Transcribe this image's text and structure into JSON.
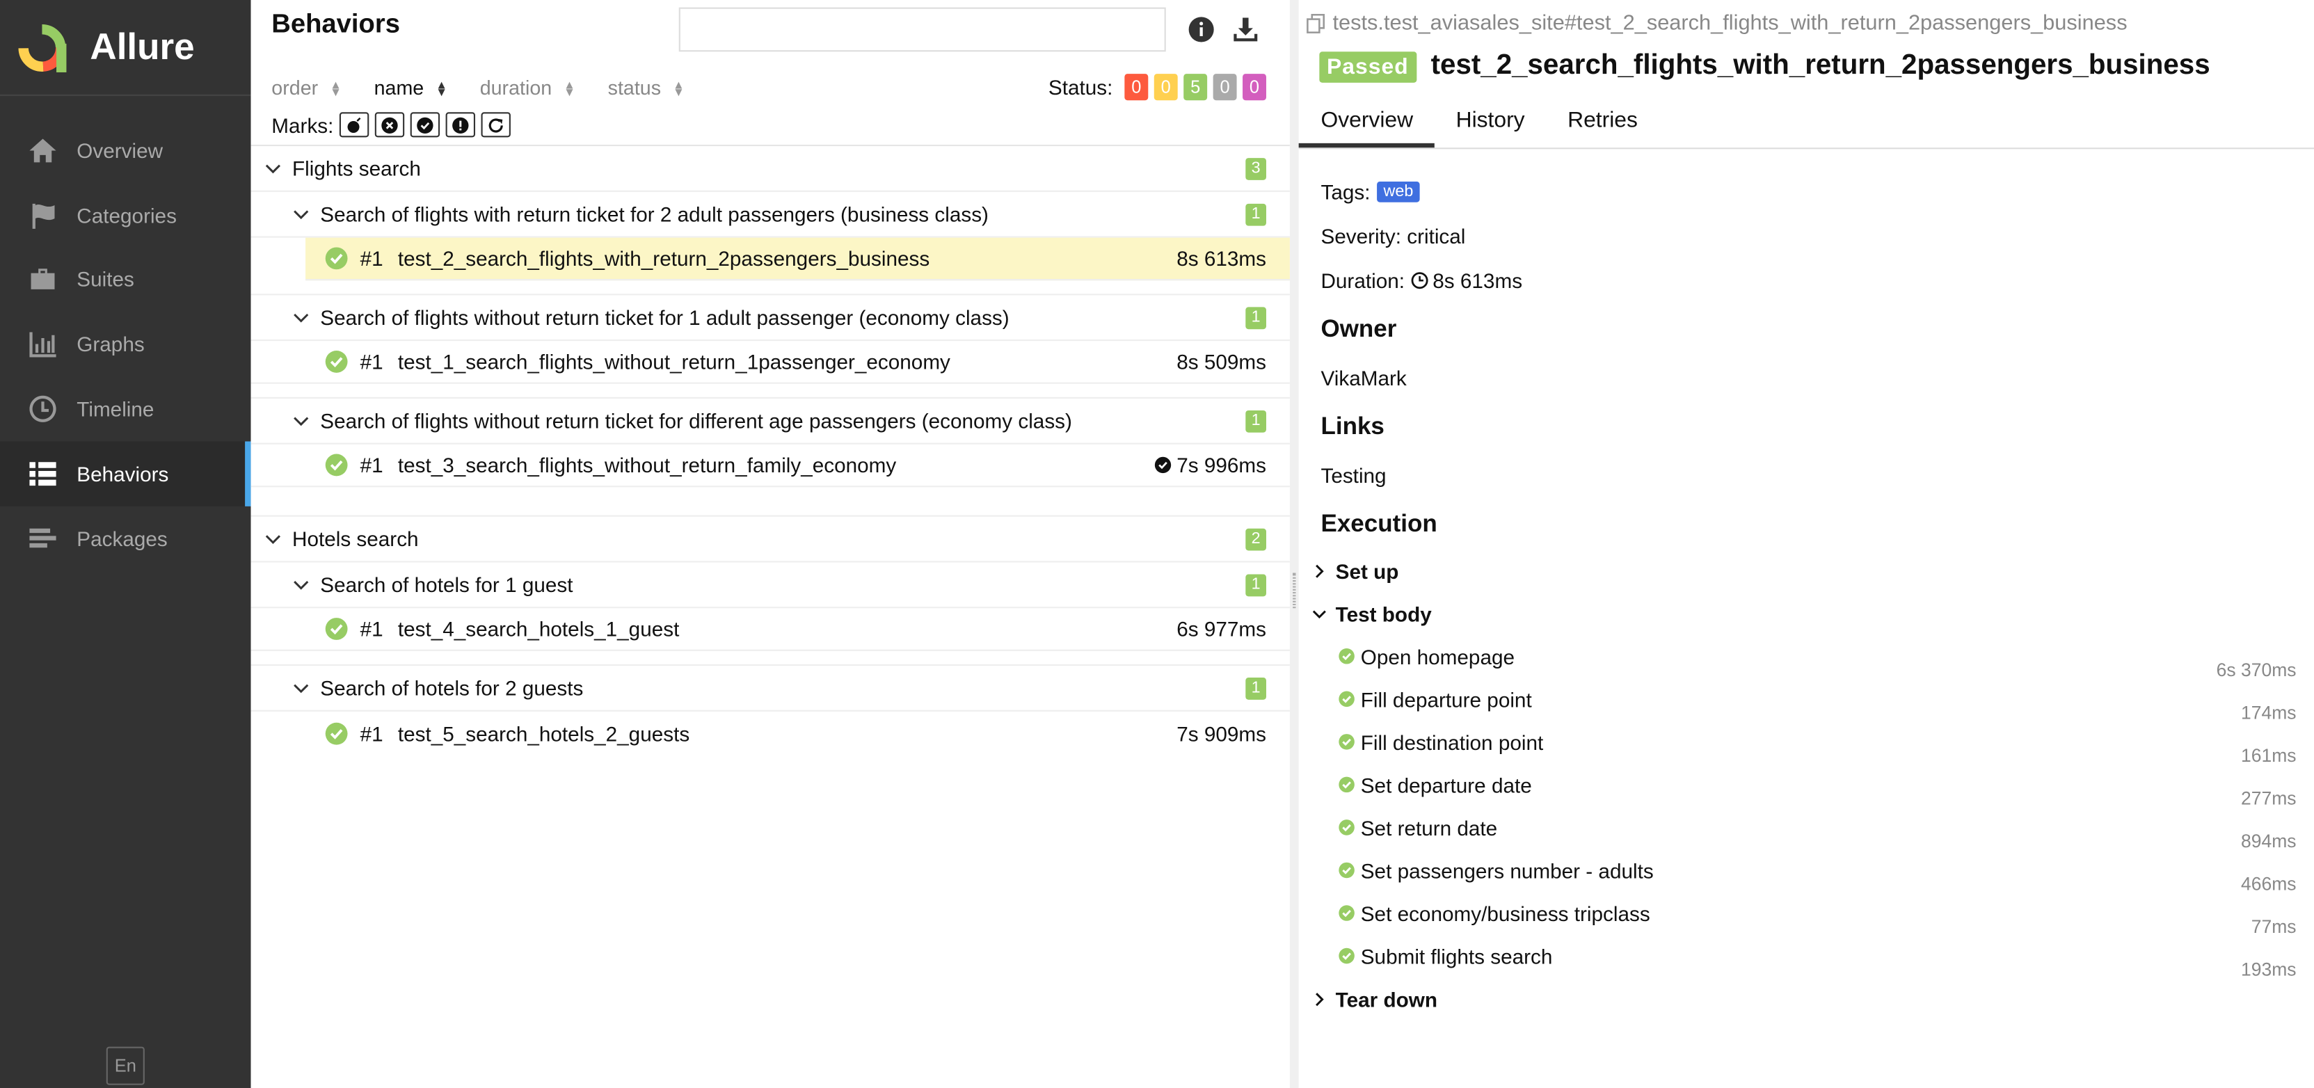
{
  "sidebar": {
    "brand": "Allure",
    "items": [
      {
        "label": "Overview",
        "icon": "home-icon"
      },
      {
        "label": "Categories",
        "icon": "flag-icon"
      },
      {
        "label": "Suites",
        "icon": "briefcase-icon"
      },
      {
        "label": "Graphs",
        "icon": "bar-chart-icon"
      },
      {
        "label": "Timeline",
        "icon": "clock-icon"
      },
      {
        "label": "Behaviors",
        "icon": "list-icon",
        "active": true
      },
      {
        "label": "Packages",
        "icon": "align-left-icon"
      }
    ],
    "language": "En"
  },
  "behaviors": {
    "title": "Behaviors",
    "search_value": "",
    "sort": {
      "order": "order",
      "name": "name",
      "duration": "duration",
      "status": "status"
    },
    "status_label": "Status:",
    "status_counts": {
      "failed": "0",
      "broken": "0",
      "passed": "5",
      "skipped": "0",
      "unknown": "0"
    },
    "marks_label": "Marks:",
    "groups": [
      {
        "name": "Flights search",
        "count": "3",
        "stories": [
          {
            "name": "Search of flights with return ticket for 2 adult passengers (business class)",
            "count": "1",
            "tests": [
              {
                "num": "#1",
                "name": "test_2_search_flights_with_return_2passengers_business",
                "duration": "8s 613ms"
              }
            ]
          },
          {
            "name": "Search of flights without return ticket for 1 adult passenger (economy class)",
            "count": "1",
            "tests": [
              {
                "num": "#1",
                "name": "test_1_search_flights_without_return_1passenger_economy",
                "duration": "8s 509ms"
              }
            ]
          },
          {
            "name": "Search of flights without return ticket for different age passengers (economy class)",
            "count": "1",
            "tests": [
              {
                "num": "#1",
                "name": "test_3_search_flights_without_return_family_economy",
                "duration": "7s 996ms"
              }
            ]
          }
        ]
      },
      {
        "name": "Hotels search",
        "count": "2",
        "stories": [
          {
            "name": "Search of hotels for 1 guest",
            "count": "1",
            "tests": [
              {
                "num": "#1",
                "name": "test_4_search_hotels_1_guest",
                "duration": "6s 977ms"
              }
            ]
          },
          {
            "name": "Search of hotels for 2 guests",
            "count": "1",
            "tests": [
              {
                "num": "#1",
                "name": "test_5_search_hotels_2_guests",
                "duration": "7s 909ms"
              }
            ]
          }
        ]
      }
    ]
  },
  "detail": {
    "breadcrumb": "tests.test_aviasales_site#test_2_search_flights_with_return_2passengers_business",
    "status": "Passed",
    "test_name": "test_2_search_flights_with_return_2passengers_business",
    "tabs": [
      "Overview",
      "History",
      "Retries"
    ],
    "tags_label": "Tags:",
    "tag": "web",
    "severity": "Severity: critical",
    "duration_label": "Duration:",
    "duration": "8s 613ms",
    "owner_heading": "Owner",
    "owner": "VikaMark",
    "links_heading": "Links",
    "link": "Testing",
    "execution_heading": "Execution",
    "setup": "Set up",
    "test_body": "Test body",
    "teardown": "Tear down",
    "steps": [
      {
        "name": "Open homepage",
        "duration": "6s 370ms"
      },
      {
        "name": "Fill departure point",
        "duration": "174ms"
      },
      {
        "name": "Fill destination point",
        "duration": "161ms"
      },
      {
        "name": "Set departure date",
        "duration": "277ms"
      },
      {
        "name": "Set return date",
        "duration": "894ms"
      },
      {
        "name": "Set passengers number - adults",
        "duration": "466ms"
      },
      {
        "name": "Set economy/business tripclass",
        "duration": "77ms"
      },
      {
        "name": "Submit flights search",
        "duration": "193ms"
      }
    ]
  },
  "colors": {
    "passed": "#97cc64",
    "failed": "#fd5a3e",
    "broken": "#ffd050",
    "skipped": "#aaaaaa",
    "unknown": "#d35ebe",
    "sidebar": "#333333",
    "accent": "#4aa7e9"
  }
}
